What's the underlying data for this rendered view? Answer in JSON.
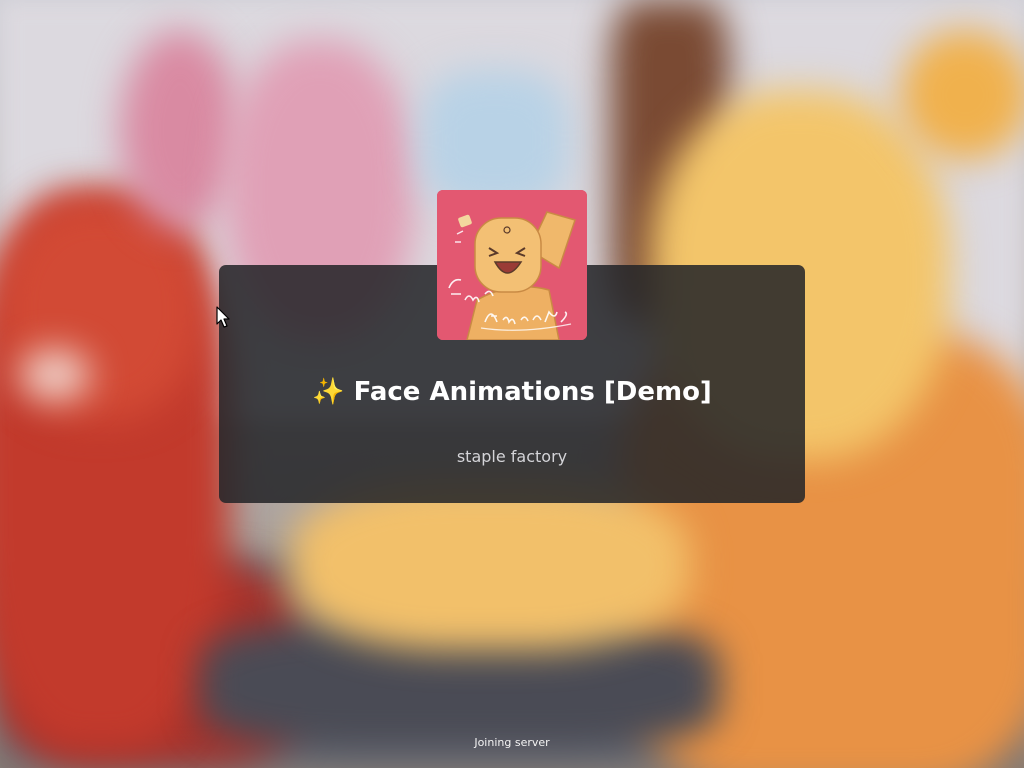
{
  "experience": {
    "title": "✨ Face Animations [Demo]",
    "creator": "staple factory",
    "icon": {
      "name": "game-thumbnail-icon",
      "lettering": "Face Animations"
    }
  },
  "status": {
    "text": "Joining server"
  },
  "colors": {
    "card_background": "#232428",
    "title_text": "#ffffff",
    "creator_text": "#d4d4d8",
    "icon_background": "#e2506b"
  }
}
